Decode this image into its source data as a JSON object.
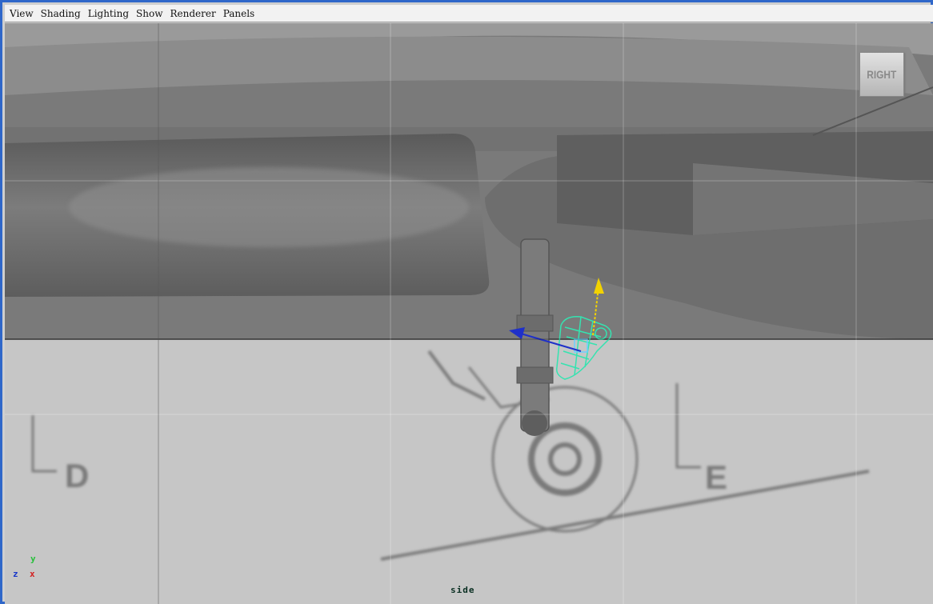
{
  "menu": {
    "items": [
      {
        "label": "View"
      },
      {
        "label": "Shading"
      },
      {
        "label": "Lighting"
      },
      {
        "label": "Show"
      },
      {
        "label": "Renderer"
      },
      {
        "label": "Panels"
      }
    ]
  },
  "viewport": {
    "camera_label": "side",
    "view_cube_label": "RIGHT",
    "reference_labels": {
      "left": "D",
      "right": "E"
    },
    "axis_indicator": {
      "y": "y",
      "z": "z",
      "x": "x"
    }
  },
  "colors": {
    "window_border": "#2f67c9",
    "selection_wireframe": "#35e3b0",
    "manip_y": "#f2d200",
    "manip_z": "#1f30c9"
  }
}
